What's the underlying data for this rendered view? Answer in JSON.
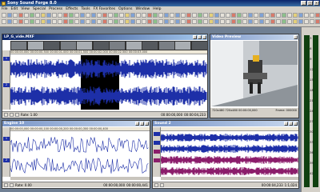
{
  "app": {
    "title": "Sony Sound Forge 8.0"
  },
  "menu": [
    "File",
    "Edit",
    "View",
    "Special",
    "Process",
    "Effects",
    "Tools",
    "FX Favorites",
    "Options",
    "Window",
    "Help"
  ],
  "colors": {
    "waveform": "#1d2fa8",
    "waveform_alt": "#8b1d6b",
    "selection": "#000000",
    "titlebar": "#0a246a",
    "meter": "#2fd62f"
  },
  "window1": {
    "title": "LP_G_vide.MXF",
    "ruler": "00:00:00.000   00:00:00.500   00:00:01.000   00:00:01.500   00:00:02.000   00:00:02.500   00:00:03.000",
    "tracks": [
      "1",
      "2"
    ],
    "rate_label": "Rate: 1.00",
    "time_start": "00:00:00,000",
    "time_end": "00:00:04,233"
  },
  "window2": {
    "title": "Engine 10",
    "ruler": "00:00:00,000  00:00:00,100  00:00:00,200  00:00:00,300  00:00:00,400",
    "tracks": [
      "1",
      "2"
    ],
    "rate_label": "Rate: 0.00",
    "time_start": "00:00:00,000",
    "time_end": "00:00:00,441"
  },
  "window3": {
    "title": "Sound 2",
    "time_end": "00:00:04,233",
    "rate_label": "1:1,024"
  },
  "video": {
    "title": "Video Preview",
    "status_line": "720x480  720x480  00:00:00,000",
    "frame_label": "Frame: 000000"
  },
  "meters": {
    "labels": [
      "-3",
      "-6",
      "-9",
      "-12",
      "-15",
      "-18",
      "-21",
      "-24",
      "-27",
      "-30",
      "-33",
      "-36",
      "-39",
      "-42"
    ]
  },
  "statusbar": {
    "left": "44,100 Hz",
    "mid": "16 bit",
    "right": "Stereo",
    "time": "00:00:06,145"
  }
}
